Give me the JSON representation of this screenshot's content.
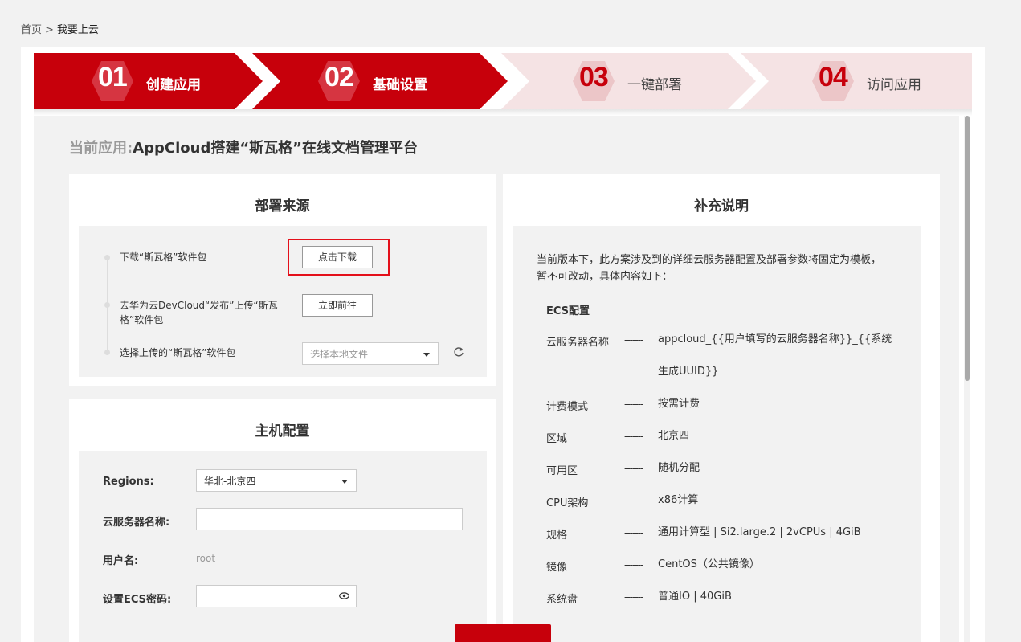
{
  "breadcrumb": {
    "home": "首页",
    "separator": ">",
    "current": "我要上云"
  },
  "steps": [
    {
      "num": "01",
      "label": "创建应用",
      "state": "active"
    },
    {
      "num": "02",
      "label": "基础设置",
      "state": "active"
    },
    {
      "num": "03",
      "label": "一键部署",
      "state": "inactive"
    },
    {
      "num": "04",
      "label": "访问应用",
      "state": "inactive"
    }
  ],
  "app": {
    "prefix": "当前应用:",
    "name": "AppCloud搭建“斯瓦格”在线文档管理平台"
  },
  "deploy_source": {
    "title": "部署来源",
    "items": [
      {
        "label": "下载“斯瓦格”软件包",
        "button": "点击下载"
      },
      {
        "label": "去华为云DevCloud“发布”上传“斯瓦格”软件包",
        "button": "立即前往"
      },
      {
        "label": "选择上传的“斯瓦格”软件包",
        "select_placeholder": "选择本地文件"
      }
    ]
  },
  "host_config": {
    "title": "主机配置",
    "regions_label": "Regions:",
    "regions_value": "华北-北京四",
    "server_name_label": "云服务器名称:",
    "server_name_value": "",
    "username_label": "用户名:",
    "username_value": "root",
    "password_label": "设置ECS密码:",
    "password_value": ""
  },
  "notes": {
    "title": "补充说明",
    "intro": "当前版本下，此方案涉及到的详细云服务器配置及部署参数将固定为模板，暂不可改动，具体内容如下：",
    "heading": "ECS配置",
    "dash": "-------",
    "rows": [
      {
        "key": "云服务器名称",
        "value": "appcloud_{{用户填写的云服务器名称}}_{{系统生成UUID}}"
      },
      {
        "key": "计费模式",
        "value": "按需计费"
      },
      {
        "key": "区域",
        "value": "北京四"
      },
      {
        "key": "可用区",
        "value": "随机分配"
      },
      {
        "key": "CPU架构",
        "value": "x86计算"
      },
      {
        "key": "规格",
        "value": "通用计算型 | Si2.large.2 | 2vCPUs | 4GiB"
      },
      {
        "key": "镜像",
        "value": "CentOS（公共镜像）"
      },
      {
        "key": "系统盘",
        "value": "普通IO | 40GiB"
      }
    ]
  },
  "colors": {
    "brand_red": "#c7000b",
    "inactive_step": "#f5e3e4",
    "highlight": "#e4101b"
  },
  "icons": {
    "refresh": "refresh-icon",
    "dropdown": "caret-down-icon",
    "password_toggle": "eye-icon"
  }
}
